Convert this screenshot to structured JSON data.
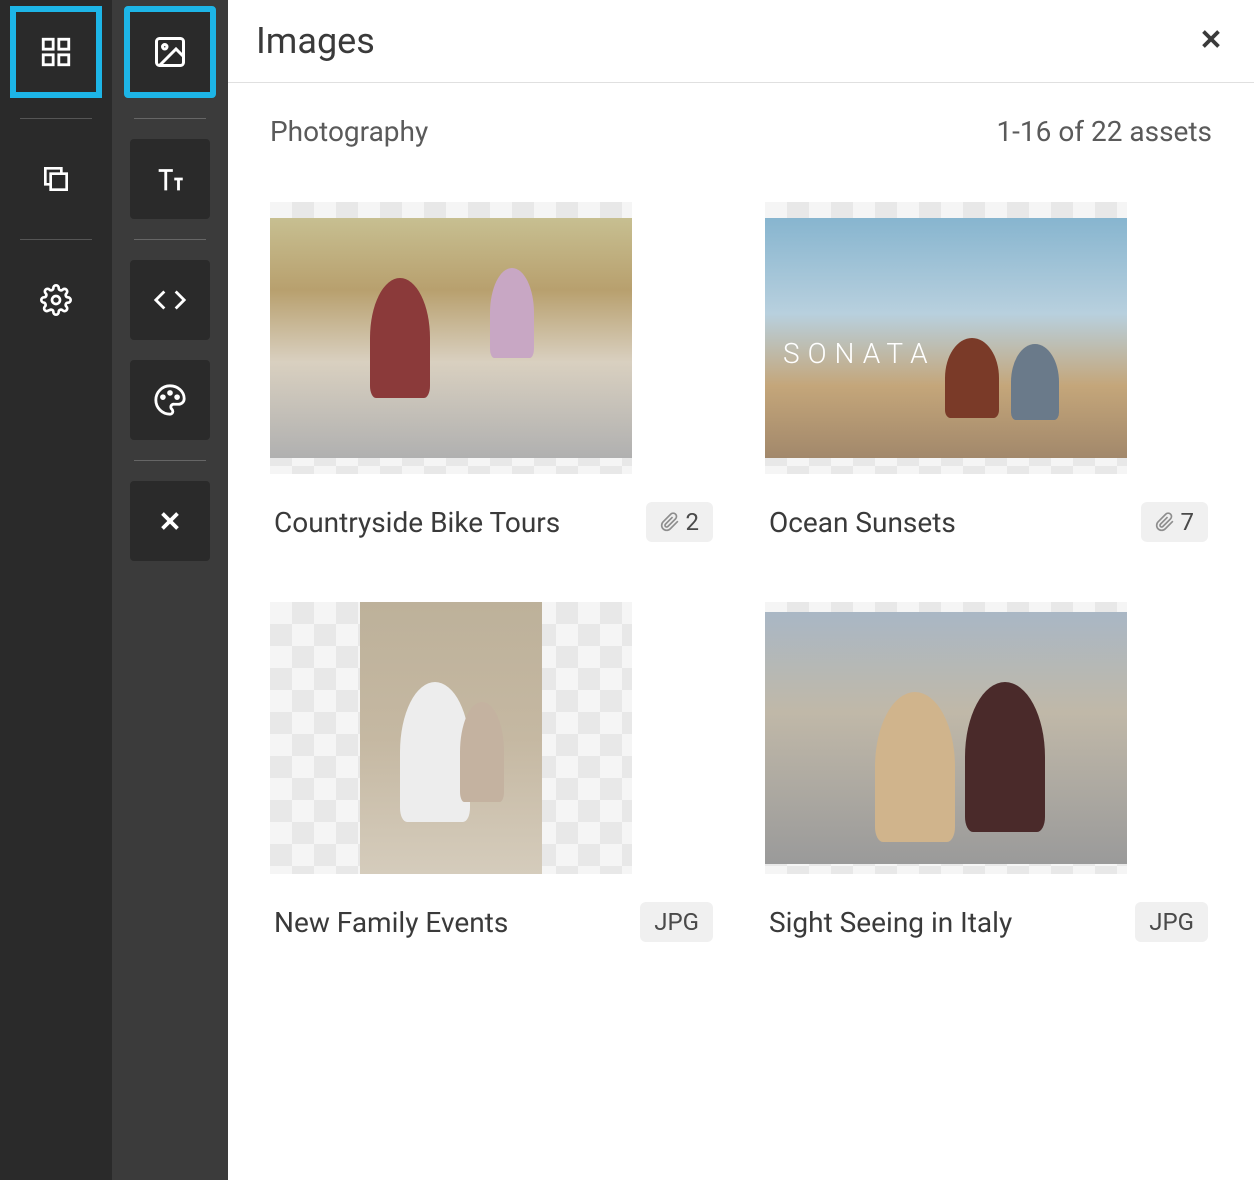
{
  "panel": {
    "title": "Images",
    "breadcrumb": "Photography",
    "count_text": "1-16 of 22 assets"
  },
  "primary_nav": {
    "items": [
      {
        "name": "grid-icon",
        "active": true
      },
      {
        "name": "copy-icon",
        "active": false
      },
      {
        "name": "gear-icon",
        "active": false
      }
    ]
  },
  "secondary_nav": {
    "items": [
      {
        "name": "image-icon",
        "active": true
      },
      {
        "name": "text-icon",
        "active": false
      },
      {
        "name": "code-icon",
        "active": false
      },
      {
        "name": "palette-icon",
        "active": false
      },
      {
        "name": "close-icon",
        "active": false
      }
    ]
  },
  "assets": [
    {
      "title": "Countryside Bike Tours",
      "badge_type": "attachments",
      "badge_value": "2"
    },
    {
      "title": "Ocean Sunsets",
      "badge_type": "attachments",
      "badge_value": "7"
    },
    {
      "title": "New Family Events",
      "badge_type": "format",
      "badge_value": "JPG"
    },
    {
      "title": "Sight Seeing in Italy",
      "badge_type": "format",
      "badge_value": "JPG"
    }
  ]
}
